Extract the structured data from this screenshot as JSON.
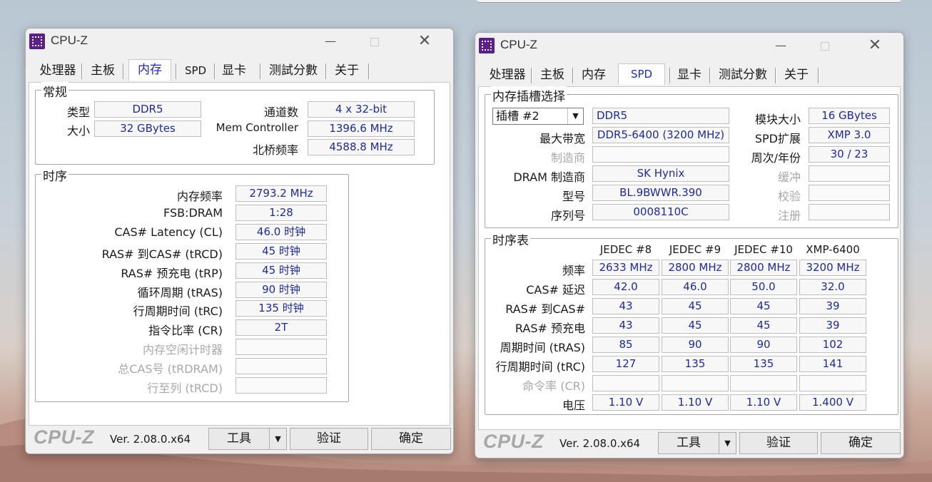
{
  "left_window": {
    "title": "CPU-Z",
    "tabs": [
      "处理器",
      "主板",
      "内存",
      "SPD",
      "显卡",
      "测試分數",
      "关于"
    ],
    "active_tab": "内存",
    "general": {
      "title": "常规",
      "type_label": "类型",
      "type_value": "DDR5",
      "size_label": "大小",
      "size_value": "32 GBytes",
      "channels_label": "通道数",
      "channels_value": "4 x 32-bit",
      "memctrl_label": "Mem Controller",
      "memctrl_value": "1396.6 MHz",
      "nb_label": "北桥频率",
      "nb_value": "4588.8 MHz"
    },
    "timings": {
      "title": "时序",
      "rows": [
        {
          "label": "内存频率",
          "value": "2793.2 MHz",
          "dim": false
        },
        {
          "label": "FSB:DRAM",
          "value": "1:28",
          "dim": false
        },
        {
          "label": "CAS# Latency (CL)",
          "value": "46.0 时钟",
          "dim": false
        },
        {
          "label": "RAS# 到CAS# (tRCD)",
          "value": "45 时钟",
          "dim": false
        },
        {
          "label": "RAS# 预充电 (tRP)",
          "value": "45 时钟",
          "dim": false
        },
        {
          "label": "循环周期 (tRAS)",
          "value": "90 时钟",
          "dim": false
        },
        {
          "label": "行周期时间 (tRC)",
          "value": "135 时钟",
          "dim": false
        },
        {
          "label": "指令比率 (CR)",
          "value": "2T",
          "dim": false
        },
        {
          "label": "内存空闲计时器",
          "value": "",
          "dim": true
        },
        {
          "label": "总CAS号 (tRDRAM)",
          "value": "",
          "dim": true
        },
        {
          "label": "行至列 (tRCD)",
          "value": "",
          "dim": true
        }
      ]
    },
    "footer": {
      "logo": "CPU-Z",
      "version": "Ver. 2.08.0.x64",
      "tools": "工具",
      "validate": "验证",
      "ok": "确定"
    }
  },
  "right_window": {
    "title": "CPU-Z",
    "tabs": [
      "处理器",
      "主板",
      "内存",
      "SPD",
      "显卡",
      "测試分數",
      "关于"
    ],
    "active_tab": "SPD",
    "slot": {
      "title": "内存插槽选择",
      "slot_select": "插槽 #2",
      "type_value": "DDR5",
      "module_size_label": "模块大小",
      "module_size_value": "16 GBytes",
      "max_bw_label": "最大带宽",
      "max_bw_value": "DDR5-6400 (3200 MHz)",
      "spd_ext_label": "SPD扩展",
      "spd_ext_value": "XMP 3.0",
      "manufacturer_label": "制造商",
      "manufacturer_value": "",
      "week_year_label": "周次/年份",
      "week_year_value": "30 / 23",
      "dram_mfr_label": "DRAM 制造商",
      "dram_mfr_value": "SK Hynix",
      "buffered_label": "缓冲",
      "buffered_value": "",
      "part_label": "型号",
      "part_value": "BL.9BWWR.390",
      "correction_label": "校验",
      "correction_value": "",
      "serial_label": "序列号",
      "serial_value": "0008110C",
      "registered_label": "注册",
      "registered_value": ""
    },
    "timing_table": {
      "title": "时序表",
      "columns": [
        "JEDEC #8",
        "JEDEC #9",
        "JEDEC #10",
        "XMP-6400"
      ],
      "rows": [
        {
          "label": "频率",
          "values": [
            "2633 MHz",
            "2800 MHz",
            "2800 MHz",
            "3200 MHz"
          ],
          "dim": false
        },
        {
          "label": "CAS# 延迟",
          "values": [
            "42.0",
            "46.0",
            "50.0",
            "32.0"
          ],
          "dim": false
        },
        {
          "label": "RAS# 到CAS#",
          "values": [
            "43",
            "45",
            "45",
            "39"
          ],
          "dim": false
        },
        {
          "label": "RAS# 预充电",
          "values": [
            "43",
            "45",
            "45",
            "39"
          ],
          "dim": false
        },
        {
          "label": "周期时间 (tRAS)",
          "values": [
            "85",
            "90",
            "90",
            "102"
          ],
          "dim": false
        },
        {
          "label": "行周期时间 (tRC)",
          "values": [
            "127",
            "135",
            "135",
            "141"
          ],
          "dim": false
        },
        {
          "label": "命令率 (CR)",
          "values": [
            "",
            "",
            "",
            ""
          ],
          "dim": true
        },
        {
          "label": "电压",
          "values": [
            "1.10 V",
            "1.10 V",
            "1.10 V",
            "1.400 V"
          ],
          "dim": false
        }
      ]
    },
    "footer": {
      "logo": "CPU-Z",
      "version": "Ver. 2.08.0.x64",
      "tools": "工具",
      "validate": "验证",
      "ok": "确定"
    }
  }
}
